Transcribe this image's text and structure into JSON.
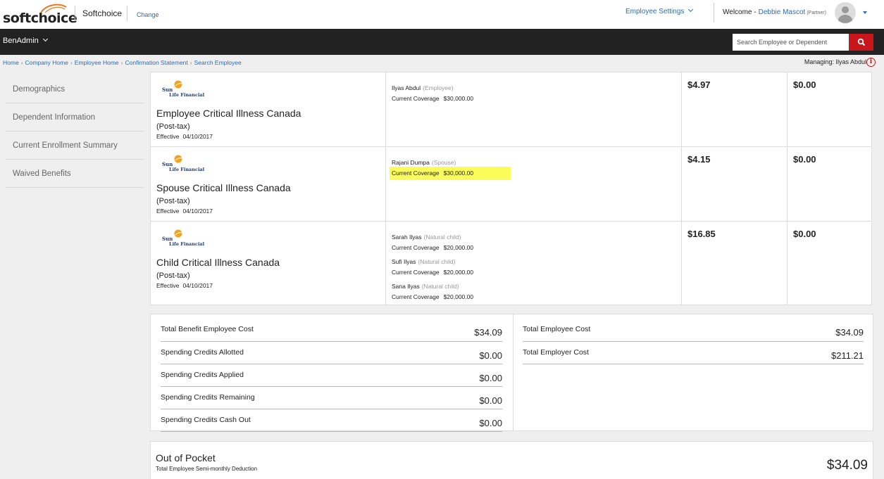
{
  "header": {
    "logo_text": "softchoice",
    "company": "Softchoice",
    "change_link": "Change",
    "employee_settings": "Employee Settings",
    "welcome_label": "Welcome -",
    "user_name": "Debbie Mascot",
    "user_role": "(Partner)"
  },
  "nav": {
    "menu_label": "BenAdmin",
    "search_placeholder": "Search Employee or Dependent"
  },
  "breadcrumb": [
    "Home",
    "Company Home",
    "Employee Home",
    "Confirmation Statement",
    "Search Employee"
  ],
  "managing": {
    "label": "Managing:",
    "name": "Ilyas Abdul"
  },
  "sidebar": {
    "items": [
      {
        "label": "Demographics"
      },
      {
        "label": "Dependent Information"
      },
      {
        "label": "Current Enrollment Summary"
      },
      {
        "label": "Waived Benefits"
      }
    ]
  },
  "benefits": [
    {
      "provider_sun": "Sun",
      "provider_life": "Life Financial",
      "name": "Employee Critical Illness Canada",
      "tax": "(Post-tax)",
      "effective_label": "Effective",
      "effective_date": "04/10/2017",
      "dependents": [
        {
          "name": "Ilyas Abdul",
          "relation": "(Employee)",
          "coverage_label": "Current Coverage",
          "coverage": "$30,000.00"
        }
      ],
      "employee_cost": "$4.97",
      "employer_cost": "$0.00"
    },
    {
      "provider_sun": "Sun",
      "provider_life": "Life Financial",
      "name": "Spouse Critical Illness Canada",
      "tax": "(Post-tax)",
      "effective_label": "Effective",
      "effective_date": "04/10/2017",
      "dependents": [
        {
          "name": "Rajani Dumpa",
          "relation": "(Spouse)",
          "coverage_label": "Current Coverage",
          "coverage": "$30,000.00"
        }
      ],
      "employee_cost": "$4.15",
      "employer_cost": "$0.00"
    },
    {
      "provider_sun": "Sun",
      "provider_life": "Life Financial",
      "name": "Child Critical Illness Canada",
      "tax": "(Post-tax)",
      "effective_label": "Effective",
      "effective_date": "04/10/2017",
      "dependents": [
        {
          "name": "Sarah Ilyas",
          "relation": "(Natural child)",
          "coverage_label": "Current Coverage",
          "coverage": "$20,000.00"
        },
        {
          "name": "Sufi Ilyas",
          "relation": "(Natural child)",
          "coverage_label": "Current Coverage",
          "coverage": "$20,000.00"
        },
        {
          "name": "Sana Ilyas",
          "relation": "(Natural child)",
          "coverage_label": "Current Coverage",
          "coverage": "$20,000.00"
        }
      ],
      "employee_cost": "$16.85",
      "employer_cost": "$0.00"
    }
  ],
  "totals_left": [
    {
      "label": "Total Benefit Employee Cost",
      "value": "$34.09"
    },
    {
      "label": "Spending Credits Allotted",
      "value": "$0.00"
    },
    {
      "label": "Spending Credits Applied",
      "value": "$0.00"
    },
    {
      "label": "Spending Credits Remaining",
      "value": "$0.00"
    },
    {
      "label": "Spending Credits Cash Out",
      "value": "$0.00"
    }
  ],
  "totals_right": [
    {
      "label": "Total Employee Cost",
      "value": "$34.09"
    },
    {
      "label": "Total Employer Cost",
      "value": "$211.21"
    }
  ],
  "out_of_pocket": {
    "title": "Out of Pocket",
    "subtitle": "Total Employee Semi-monthly Deduction",
    "value": "$34.09"
  },
  "colors": {
    "brand_red": "#c9161b",
    "link_blue": "#2a6db5",
    "nav_bg": "#222222",
    "highlight": "#fbfb5a"
  }
}
